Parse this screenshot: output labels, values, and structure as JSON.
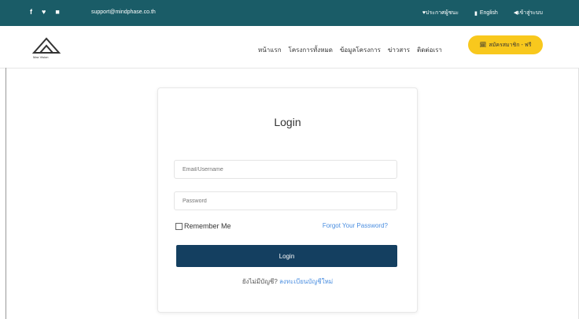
{
  "topbar": {
    "social": [
      "f",
      "♥",
      "■"
    ],
    "email": "support@mindphase.co.th",
    "links": [
      "♥ประกาศผู้ชนะ",
      "English",
      "◀เข้าสู่ระบบ"
    ]
  },
  "navbar": {
    "logo_text": "Max Vision",
    "menu": [
      "หน้าแรก",
      "โครงการทั้งหมด",
      "ข้อมูลโครงการ",
      "ข่าวสาร",
      "ติดต่อเรา"
    ],
    "cta_icon": "🗓",
    "cta_label": "สมัครสมาชิก - ฟรี"
  },
  "login": {
    "title": "Login",
    "email_placeholder": "Email/Username",
    "password_placeholder": "Password",
    "remember_label": "Remember Me",
    "forgot_label": "Forgot Your Password?",
    "button_label": "Login",
    "signup_prompt": "ยังไม่มีบัญชี?",
    "signup_link": "ลงทะเบียนบัญชีใหม่"
  }
}
